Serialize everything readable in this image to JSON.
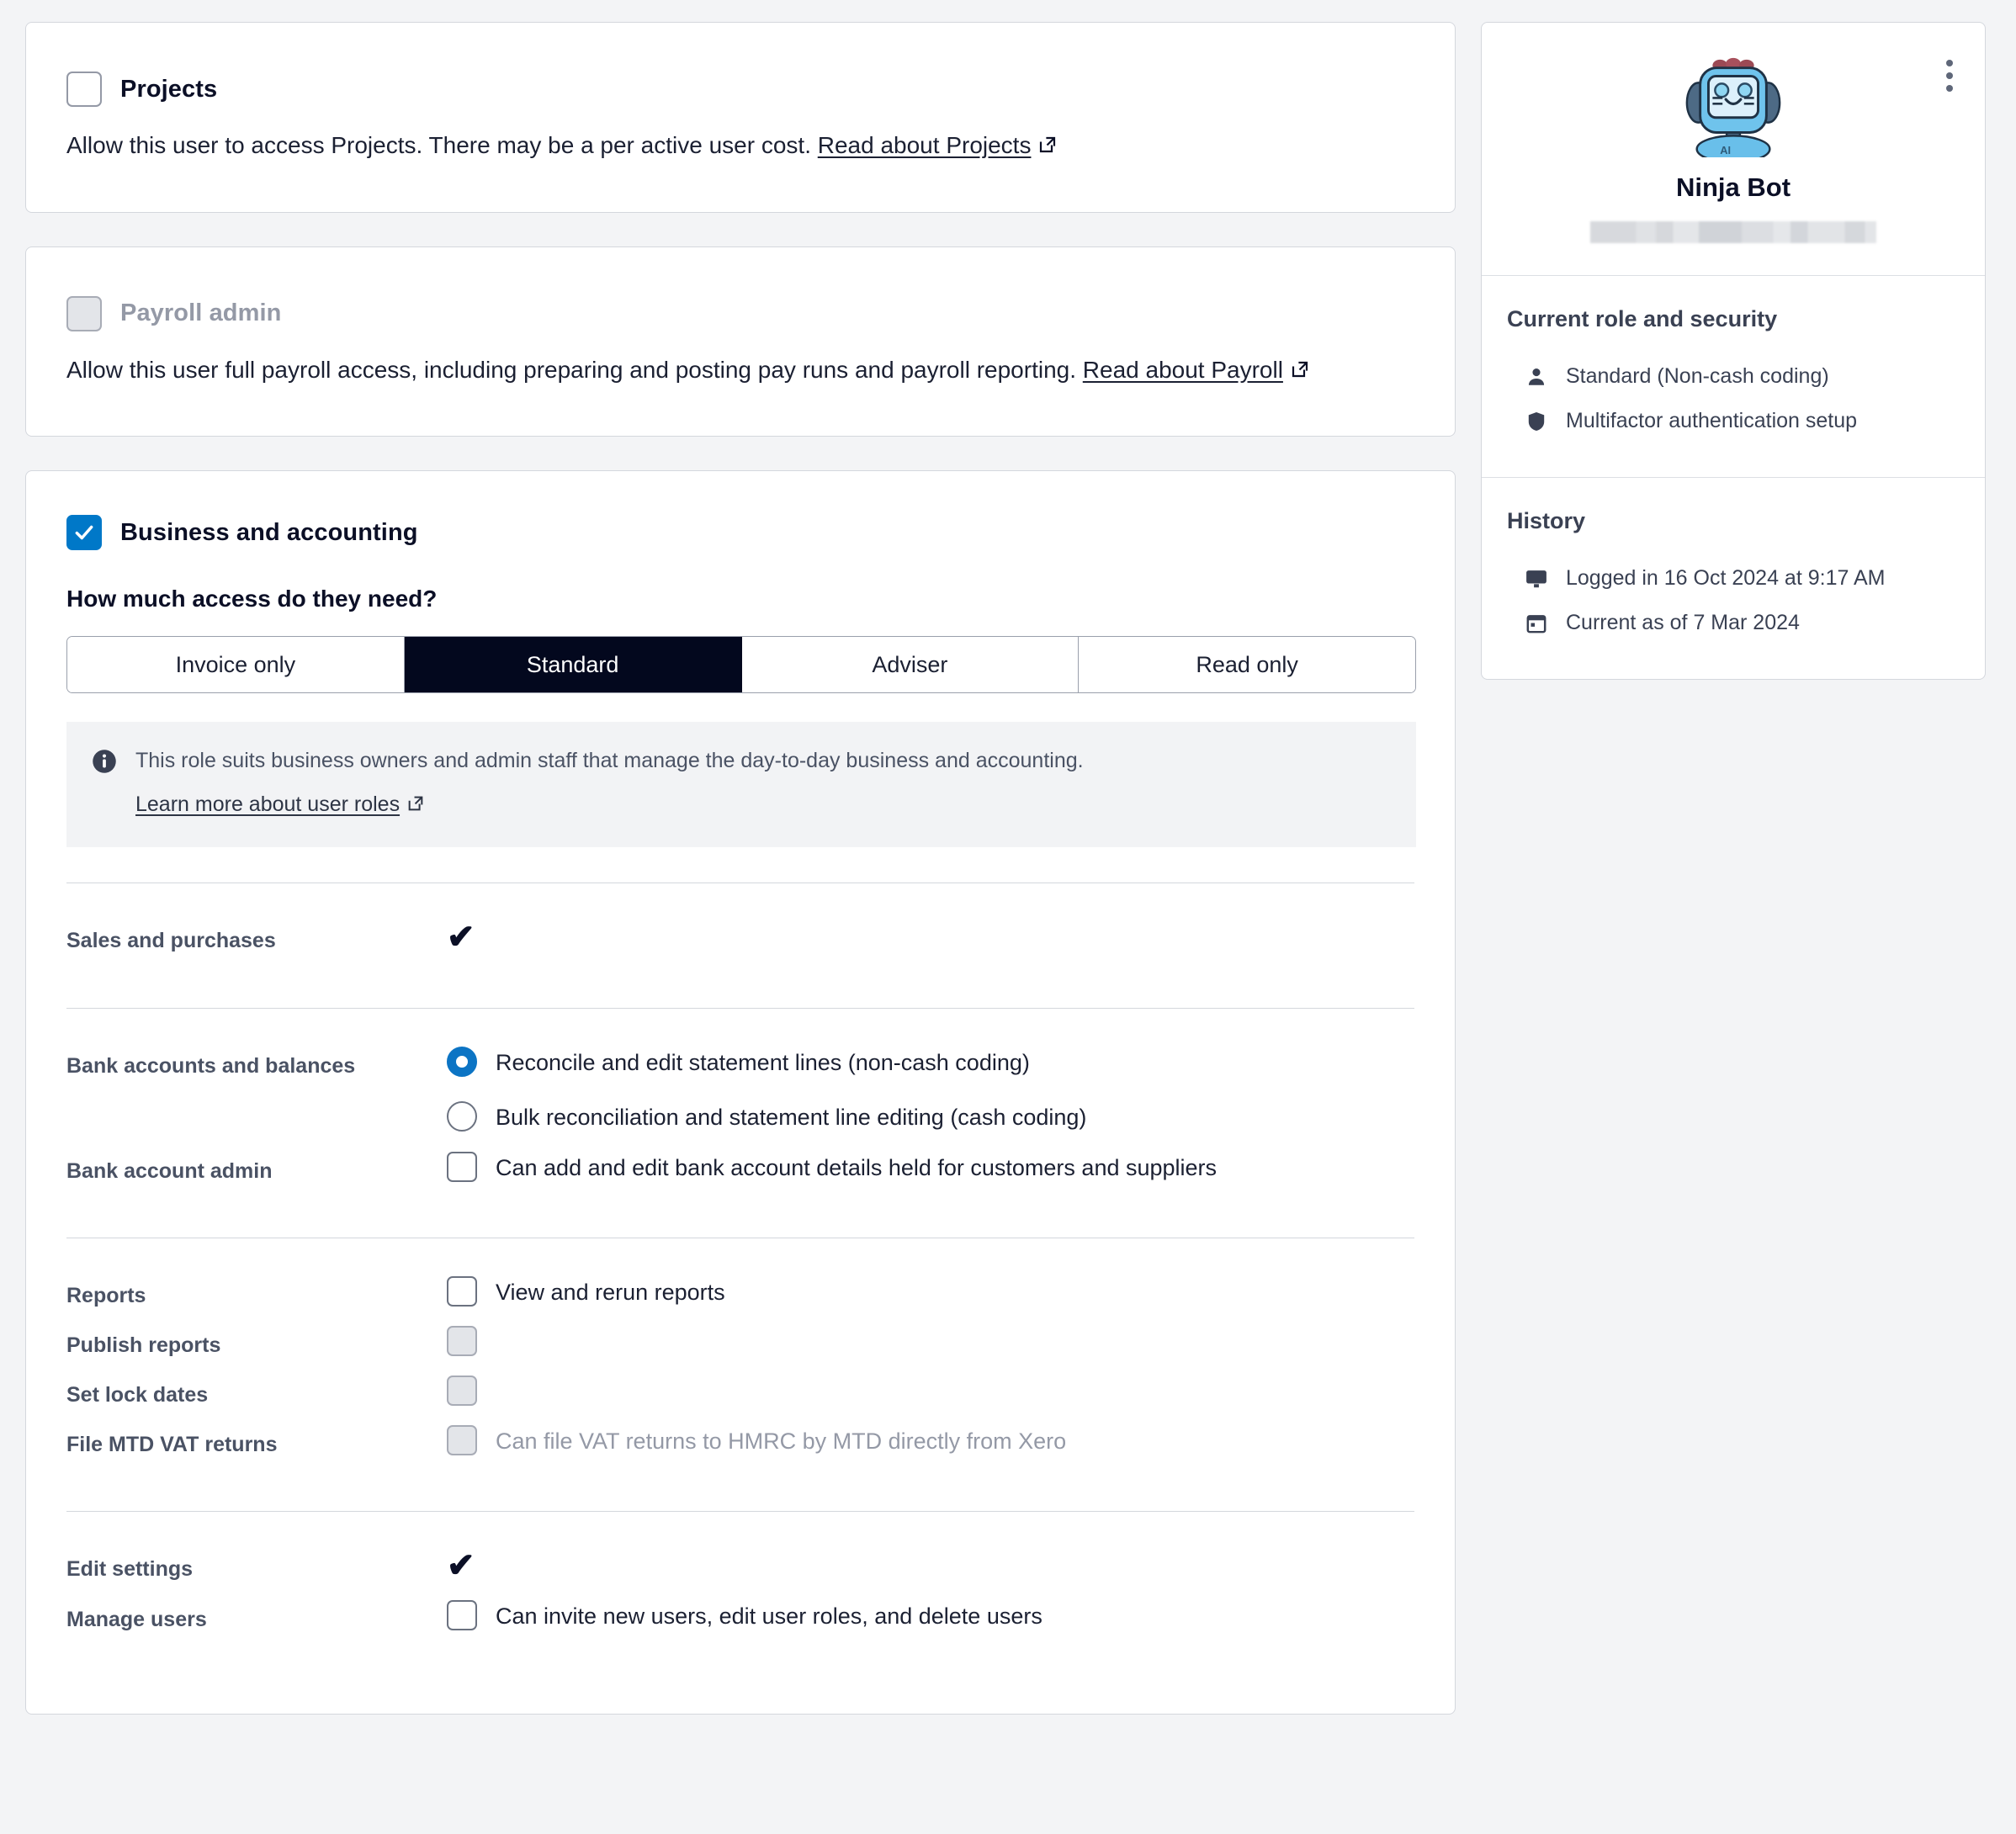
{
  "colors": {
    "accent_blue": "#0078C8",
    "radio_blue": "#0C74C4",
    "selected_tab_bg": "#03081E",
    "page_bg": "#F3F4F6",
    "card_border": "#D4D7DD",
    "label_gray": "#4A5264",
    "muted_gray": "#9499A6"
  },
  "projects_card": {
    "checkbox_label": "Projects",
    "checked": false,
    "description_prefix": "Allow this user to access Projects. There may be a per active user cost. ",
    "link_text": "Read about Projects",
    "link_icon": "external-link-icon"
  },
  "payroll_card": {
    "checkbox_label": "Payroll admin",
    "checked": false,
    "disabled": true,
    "description_prefix": "Allow this user full payroll access, including preparing and posting pay runs and payroll reporting. ",
    "link_text": "Read about Payroll",
    "link_icon": "external-link-icon"
  },
  "business_card": {
    "checkbox_label": "Business and accounting",
    "checked": true,
    "question": "How much access do they need?",
    "access_levels": [
      {
        "label": "Invoice only",
        "selected": false
      },
      {
        "label": "Standard",
        "selected": true
      },
      {
        "label": "Adviser",
        "selected": false
      },
      {
        "label": "Read only",
        "selected": false
      }
    ],
    "info": {
      "icon": "info-icon",
      "text": "This role suits business owners and admin staff that manage the day-to-day business and accounting.",
      "link_text": "Learn more about user roles",
      "link_icon": "external-link-icon"
    },
    "groups": [
      {
        "rows": [
          {
            "label": "Sales and purchases",
            "control": "tick",
            "tick": "✔"
          }
        ]
      },
      {
        "rows": [
          {
            "label": "Bank accounts and balances",
            "control": "radio-group",
            "options": [
              {
                "text": "Reconcile and edit statement lines (non-cash coding)",
                "selected": true
              },
              {
                "text": "Bulk reconciliation and statement line editing (cash coding)",
                "selected": false
              }
            ]
          },
          {
            "label": "Bank account admin",
            "control": "checkbox",
            "options": [
              {
                "text": "Can add and edit bank account details held for customers and suppliers",
                "checked": false,
                "disabled": false
              }
            ]
          }
        ]
      },
      {
        "rows": [
          {
            "label": "Reports",
            "control": "checkbox",
            "options": [
              {
                "text": "View and rerun reports",
                "checked": false,
                "disabled": false
              }
            ]
          },
          {
            "label": "Publish reports",
            "control": "checkbox",
            "options": [
              {
                "text": "",
                "checked": false,
                "disabled": true
              }
            ]
          },
          {
            "label": "Set lock dates",
            "control": "checkbox",
            "options": [
              {
                "text": "",
                "checked": false,
                "disabled": true
              }
            ]
          },
          {
            "label": "File MTD VAT returns",
            "control": "checkbox",
            "options": [
              {
                "text": "Can file VAT returns to HMRC by MTD directly from Xero",
                "checked": false,
                "disabled": true
              }
            ]
          }
        ]
      },
      {
        "rows": [
          {
            "label": "Edit settings",
            "control": "tick",
            "tick": "✔"
          },
          {
            "label": "Manage users",
            "control": "checkbox",
            "options": [
              {
                "text": "Can invite new users, edit user roles, and delete users",
                "checked": false,
                "disabled": false
              }
            ]
          }
        ]
      }
    ]
  },
  "sidebar": {
    "avatar_icon": "robot-avatar-icon",
    "menu_icon": "kebab-menu-icon",
    "name": "Ninja Bot",
    "email_redacted": true,
    "role_section": {
      "title": "Current role and security",
      "items": [
        {
          "icon": "person-icon",
          "label": "Standard (Non-cash coding)"
        },
        {
          "icon": "shield-icon",
          "label": "Multifactor authentication setup"
        }
      ]
    },
    "history_section": {
      "title": "History",
      "items": [
        {
          "icon": "monitor-icon",
          "label": "Logged in 16 Oct 2024 at 9:17 AM"
        },
        {
          "icon": "calendar-icon",
          "label": "Current as of 7 Mar 2024"
        }
      ]
    }
  }
}
